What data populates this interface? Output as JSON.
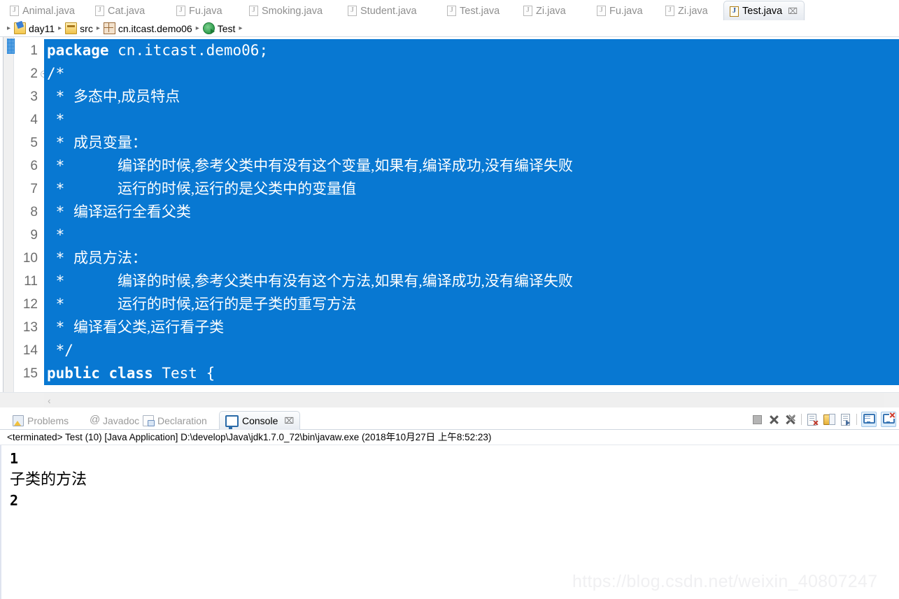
{
  "editor_tabs": [
    {
      "label": "Animal.java",
      "icon": "java-file-icon",
      "active": false
    },
    {
      "label": "Cat.java",
      "icon": "java-file-icon",
      "active": false
    },
    {
      "label": "Fu.java",
      "icon": "java-file-icon",
      "active": false
    },
    {
      "label": "Smoking.java",
      "icon": "java-file-icon",
      "active": false
    },
    {
      "label": "Student.java",
      "icon": "java-file-icon",
      "active": false
    },
    {
      "label": "Test.java",
      "icon": "java-file-icon",
      "active": false
    },
    {
      "label": "Zi.java",
      "icon": "java-file-icon",
      "active": false
    },
    {
      "label": "Fu.java",
      "icon": "java-file-icon",
      "active": false
    },
    {
      "label": "Zi.java",
      "icon": "java-file-icon",
      "active": false
    },
    {
      "label": "Test.java",
      "icon": "java-file-icon",
      "active": true,
      "close": "⌧"
    }
  ],
  "breadcrumb": {
    "separator": "▸",
    "items": [
      {
        "label": "day11",
        "icon": "project-icon"
      },
      {
        "label": "src",
        "icon": "source-folder-icon"
      },
      {
        "label": "cn.itcast.demo06",
        "icon": "package-icon"
      },
      {
        "label": "Test",
        "icon": "class-icon"
      }
    ]
  },
  "editor": {
    "selection_color": "#0878d2",
    "fold_marker": "⊖",
    "hscroll_left_arrow": "‹",
    "lines": [
      {
        "no": "1",
        "fold": false,
        "segments": [
          {
            "t": "package ",
            "k": true
          },
          {
            "t": "cn.itcast.demo06;",
            "k": false
          }
        ]
      },
      {
        "no": "2",
        "fold": true,
        "segments": [
          {
            "t": "/*",
            "k": false
          }
        ]
      },
      {
        "no": "3",
        "fold": false,
        "segments": [
          {
            "t": " * ",
            "k": false
          },
          {
            "t": "多态中,成员特点",
            "k": false,
            "cn": true
          }
        ]
      },
      {
        "no": "4",
        "fold": false,
        "segments": [
          {
            "t": " * ",
            "k": false
          }
        ]
      },
      {
        "no": "5",
        "fold": false,
        "segments": [
          {
            "t": " * ",
            "k": false
          },
          {
            "t": "成员变量：",
            "k": false,
            "cn": true
          }
        ]
      },
      {
        "no": "6",
        "fold": false,
        "segments": [
          {
            "t": " * 　　　",
            "k": false
          },
          {
            "t": "编译的时候,参考父类中有没有这个变量,如果有,编译成功,没有编译失败",
            "k": false,
            "cn": true
          }
        ]
      },
      {
        "no": "7",
        "fold": false,
        "segments": [
          {
            "t": " * 　　　",
            "k": false
          },
          {
            "t": "运行的时候,运行的是父类中的变量值",
            "k": false,
            "cn": true
          }
        ]
      },
      {
        "no": "8",
        "fold": false,
        "segments": [
          {
            "t": " * ",
            "k": false
          },
          {
            "t": "编译运行全看父类",
            "k": false,
            "cn": true
          }
        ]
      },
      {
        "no": "9",
        "fold": false,
        "segments": [
          {
            "t": " * ",
            "k": false
          }
        ]
      },
      {
        "no": "10",
        "fold": false,
        "segments": [
          {
            "t": " * ",
            "k": false
          },
          {
            "t": "成员方法：",
            "k": false,
            "cn": true
          }
        ]
      },
      {
        "no": "11",
        "fold": false,
        "segments": [
          {
            "t": " * 　　　",
            "k": false
          },
          {
            "t": "编译的时候,参考父类中有没有这个方法,如果有,编译成功,没有编译失败",
            "k": false,
            "cn": true
          }
        ]
      },
      {
        "no": "12",
        "fold": false,
        "segments": [
          {
            "t": " * 　　　",
            "k": false
          },
          {
            "t": "运行的时候,运行的是子类的重写方法",
            "k": false,
            "cn": true
          }
        ]
      },
      {
        "no": "13",
        "fold": false,
        "segments": [
          {
            "t": " * ",
            "k": false
          },
          {
            "t": "编译看父类,运行看子类",
            "k": false,
            "cn": true
          }
        ]
      },
      {
        "no": "14",
        "fold": false,
        "segments": [
          {
            "t": " */",
            "k": false
          }
        ]
      },
      {
        "no": "15",
        "fold": false,
        "segments": [
          {
            "t": "public class ",
            "k": true
          },
          {
            "t": "Test {",
            "k": false
          }
        ]
      }
    ]
  },
  "console_view": {
    "tabs": [
      {
        "label": "Problems",
        "icon": "problems-icon",
        "active": false
      },
      {
        "label": "Javadoc",
        "icon": "javadoc-icon",
        "active": false
      },
      {
        "label": "Declaration",
        "icon": "declaration-icon",
        "active": false
      },
      {
        "label": "Console",
        "icon": "console-icon",
        "active": true,
        "close": "⌧"
      }
    ],
    "toolbar": [
      {
        "name": "terminate-button",
        "enabled": false
      },
      {
        "name": "remove-launch-button",
        "enabled": true
      },
      {
        "name": "remove-all-terminated-button",
        "enabled": true
      },
      {
        "name": "clear-console-button",
        "enabled": true
      },
      {
        "name": "scroll-lock-button",
        "enabled": true
      },
      {
        "name": "word-wrap-button",
        "enabled": true
      },
      {
        "name": "display-selected-console-button",
        "enabled": true,
        "toggled": true
      },
      {
        "name": "open-console-button",
        "enabled": true,
        "toggled": true
      }
    ],
    "launch_line": "<terminated> Test (10) [Java Application] D:\\develop\\Java\\jdk1.7.0_72\\bin\\javaw.exe (2018年10月27日 上午8:52:23)",
    "output": [
      {
        "text": "1",
        "cn": false
      },
      {
        "text": "子类的方法",
        "cn": true
      },
      {
        "text": "2",
        "cn": false
      }
    ]
  },
  "watermark": {
    "text": "https://blog.csdn.net/weixin_40807247"
  }
}
